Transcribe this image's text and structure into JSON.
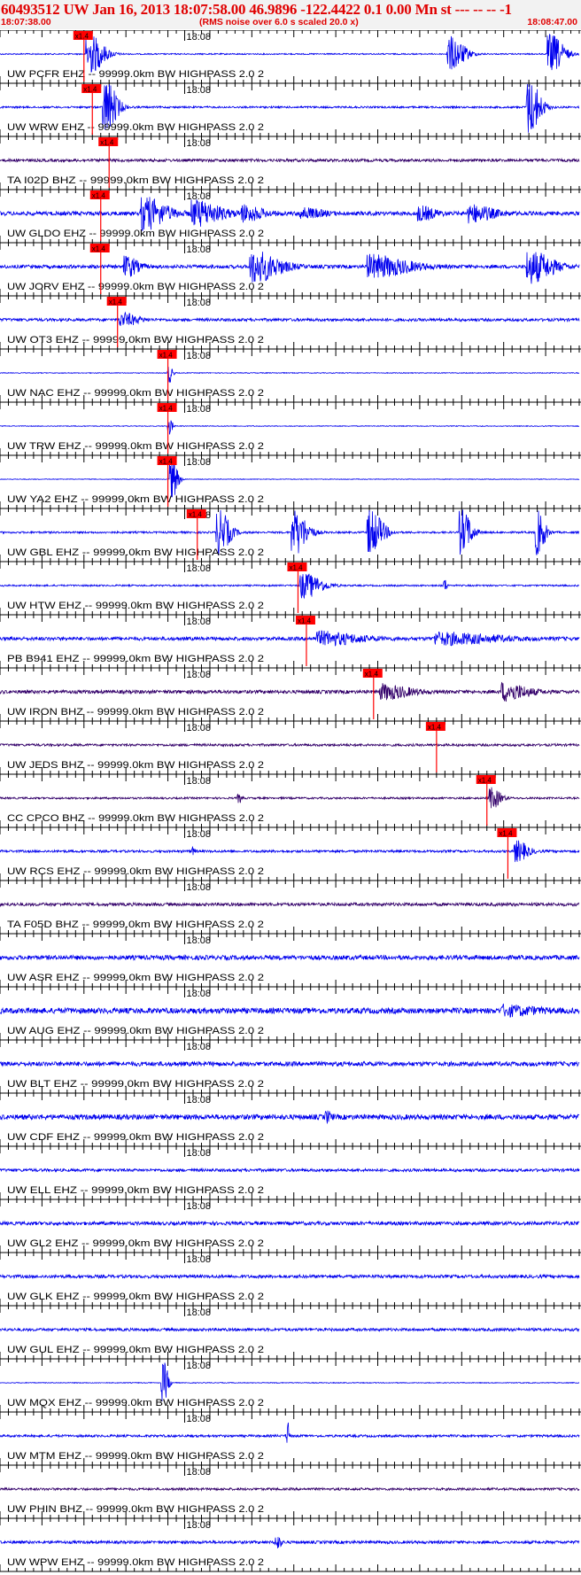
{
  "header": {
    "title": "60493512 UW Jan 16, 2013 18:07:58.00   46.9896 -122.4422  0.1 0.00 Mn st --- -- --  -1",
    "start_time": "18:07:38.00",
    "rms_note": "(RMS noise over 6.0 s scaled 20.0 x)",
    "end_time": "18:08:47.00"
  },
  "chart_data": {
    "type": "line",
    "title": "",
    "x_range_seconds": [
      0,
      69
    ],
    "minute_label": "18:08",
    "minute_mark_seconds": 22,
    "pick_label": "x1.4",
    "trace_color": "#0000ee",
    "pick_color": "#ff0000",
    "traces": [
      {
        "label": "UW PCFR EHZ -- 99999.0km BW  HIGHPASS  2.0  2",
        "pick": 10.0,
        "bursts": [
          [
            10.5,
            4,
            2.6
          ],
          [
            53.5,
            4,
            2.2
          ],
          [
            65.5,
            3.5,
            2.5
          ]
        ],
        "noise": 0.08,
        "color": "#0000ee"
      },
      {
        "label": "UW WRW EHZ -- 99999.0km BW  HIGHPASS  2.0  2",
        "pick": 11.0,
        "bursts": [
          [
            12.5,
            3,
            3.5
          ],
          [
            63.0,
            3,
            3.5
          ]
        ],
        "noise": 0.12,
        "color": "#0000ee"
      },
      {
        "label": "TA I02D BHZ -- 99999.0km BW  HIGHPASS  2.0  2",
        "pick": 13.0,
        "bursts": [],
        "noise": 0.18,
        "color": "#33006a"
      },
      {
        "label": "UW GLDO EHZ -- 99999.0km BW  HIGHPASS  2.0  2",
        "pick": 12.0,
        "bursts": [
          [
            17,
            6,
            2.0
          ],
          [
            23,
            7,
            1.6
          ],
          [
            29,
            5,
            0.9
          ],
          [
            36,
            5,
            0.6
          ],
          [
            50,
            4,
            0.8
          ],
          [
            56,
            6,
            1.0
          ]
        ],
        "noise": 0.25,
        "color": "#0000ee"
      },
      {
        "label": "UW JORV EHZ -- 99999.0km BW  HIGHPASS  2.0  2",
        "pick": 12.0,
        "bursts": [
          [
            15,
            3,
            1.3
          ],
          [
            30,
            7,
            2.0
          ],
          [
            44,
            10,
            1.4
          ],
          [
            63,
            6,
            2.0
          ]
        ],
        "noise": 0.22,
        "color": "#0000ee"
      },
      {
        "label": "UW OT3 EHZ -- 99999.0km BW  HIGHPASS  2.0  2",
        "pick": 14.0,
        "bursts": [
          [
            14.5,
            4,
            0.8
          ]
        ],
        "noise": 0.18,
        "color": "#0000ee"
      },
      {
        "label": "UW NAC EHZ -- 99999.0km BW  HIGHPASS  2.0  2",
        "pick": 20.0,
        "bursts": [
          [
            20.2,
            0.8,
            1.2
          ]
        ],
        "noise": 0.05,
        "color": "#0000ee"
      },
      {
        "label": "UW TRW EHZ -- 99999.0km BW  HIGHPASS  2.0  2",
        "pick": 20.0,
        "bursts": [
          [
            20.2,
            0.8,
            1.0
          ]
        ],
        "noise": 0.05,
        "color": "#0000ee"
      },
      {
        "label": "UW YA2 EHZ -- 99999.0km BW  HIGHPASS  2.0  2",
        "pick": 20.0,
        "bursts": [
          [
            20.5,
            1.5,
            2.5
          ]
        ],
        "noise": 0.04,
        "color": "#0000ee"
      },
      {
        "label": "UW GBL EHZ -- 99999.0km BW  HIGHPASS  2.0  2",
        "pick": 23.5,
        "bursts": [
          [
            26,
            3,
            2.8
          ],
          [
            35,
            3.5,
            2.8
          ],
          [
            44,
            3.5,
            2.8
          ],
          [
            55,
            2.5,
            2.8
          ],
          [
            64,
            2,
            2.8
          ]
        ],
        "noise": 0.12,
        "color": "#0000ee"
      },
      {
        "label": "UW HTW EHZ -- 99999.0km BW  HIGHPASS  2.0  2",
        "pick": 35.5,
        "bursts": [
          [
            36,
            5,
            1.6
          ],
          [
            53,
            0.5,
            0.8
          ]
        ],
        "noise": 0.1,
        "color": "#0000ee"
      },
      {
        "label": "PB B941 EHZ -- 99999.0km BW  HIGHPASS  2.0  2",
        "pick": 36.5,
        "bursts": [
          [
            38,
            10,
            0.8
          ],
          [
            52,
            15,
            0.7
          ]
        ],
        "noise": 0.22,
        "color": "#0000ee"
      },
      {
        "label": "UW IRON BHZ -- 99999.0km BW  HIGHPASS  2.0  2",
        "pick": 44.5,
        "bursts": [
          [
            45.5,
            7,
            0.9
          ],
          [
            60,
            6,
            1.1
          ]
        ],
        "noise": 0.22,
        "color": "#33006a"
      },
      {
        "label": "UW JEDS BHZ -- 99999.0km BW  HIGHPASS  2.0  2",
        "pick": 52.0,
        "bursts": [],
        "noise": 0.15,
        "color": "#33006a"
      },
      {
        "label": "CC CPCO BHZ -- 99999.0km BW  HIGHPASS  2.0  2",
        "pick": 58.0,
        "bursts": [
          [
            28.5,
            0.6,
            0.6
          ],
          [
            58.5,
            2.5,
            1.3
          ]
        ],
        "noise": 0.12,
        "color": "#33006a"
      },
      {
        "label": "UW RCS EHZ -- 99999.0km BW  HIGHPASS  2.0  2",
        "pick": 60.5,
        "bursts": [
          [
            61.5,
            3,
            1.3
          ],
          [
            23,
            0.5,
            0.5
          ]
        ],
        "noise": 0.15,
        "color": "#0000ee"
      },
      {
        "label": "TA F05D BHZ -- 99999.0km BW  HIGHPASS  2.0  2",
        "pick": null,
        "bursts": [],
        "noise": 0.2,
        "color": "#33006a"
      },
      {
        "label": "UW ASR EHZ -- 99999.0km BW  HIGHPASS  2.0  2",
        "pick": null,
        "bursts": [],
        "noise": 0.28,
        "color": "#0000ee"
      },
      {
        "label": "UW AUG EHZ -- 99999.0km BW  HIGHPASS  2.0  2",
        "pick": null,
        "bursts": [
          [
            60,
            8,
            0.5
          ]
        ],
        "noise": 0.35,
        "color": "#0000ee"
      },
      {
        "label": "UW BLT EHZ -- 99999.0km BW  HIGHPASS  2.0  2",
        "pick": null,
        "bursts": [],
        "noise": 0.28,
        "color": "#0000ee"
      },
      {
        "label": "UW CDF EHZ -- 99999.0km BW  HIGHPASS  2.0  2",
        "pick": null,
        "bursts": [
          [
            39,
            1,
            0.6
          ]
        ],
        "noise": 0.32,
        "color": "#0000ee"
      },
      {
        "label": "UW ELL EHZ -- 99999.0km BW  HIGHPASS  2.0  2",
        "pick": null,
        "bursts": [],
        "noise": 0.18,
        "color": "#0000ee"
      },
      {
        "label": "UW GL2 EHZ -- 99999.0km BW  HIGHPASS  2.0  2",
        "pick": null,
        "bursts": [],
        "noise": 0.22,
        "color": "#0000ee"
      },
      {
        "label": "UW GLK EHZ -- 99999.0km BW  HIGHPASS  2.0  2",
        "pick": null,
        "bursts": [],
        "noise": 0.2,
        "color": "#0000ee"
      },
      {
        "label": "UW GUL EHZ -- 99999.0km BW  HIGHPASS  2.0  2",
        "pick": null,
        "bursts": [],
        "noise": 0.18,
        "color": "#0000ee"
      },
      {
        "label": "UW MQX EHZ -- 99999.0km BW  HIGHPASS  2.0  2",
        "pick": null,
        "bursts": [
          [
            19.5,
            1.2,
            2.6
          ]
        ],
        "noise": 0.05,
        "color": "#0000ee"
      },
      {
        "label": "UW MTM EHZ -- 99999.0km BW  HIGHPASS  2.0  2",
        "pick": null,
        "bursts": [
          [
            34.3,
            0.3,
            2.4
          ]
        ],
        "noise": 0.15,
        "color": "#0000ee"
      },
      {
        "label": "UW PHIN BHZ -- 99999.0km BW  HIGHPASS  2.0  2",
        "pick": null,
        "bursts": [],
        "noise": 0.15,
        "color": "#33006a"
      },
      {
        "label": "UW WPW EHZ -- 99999.0km BW  HIGHPASS  2.0  2",
        "pick": null,
        "bursts": [
          [
            33,
            1,
            0.8
          ]
        ],
        "noise": 0.18,
        "color": "#0000ee"
      }
    ]
  }
}
